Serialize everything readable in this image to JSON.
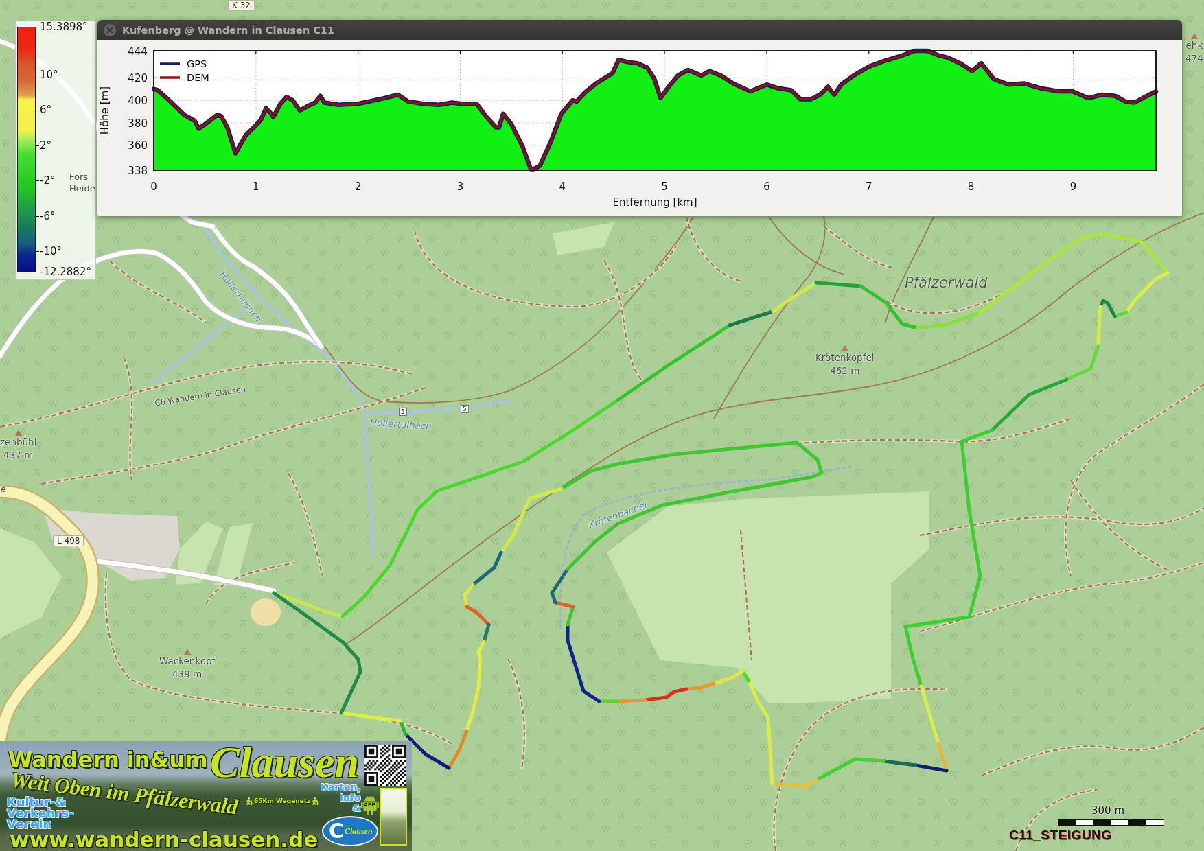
{
  "colorbar": {
    "max_label": "15.3898°",
    "ticks": [
      "10°",
      "6°",
      "2°",
      "-2°",
      "-6°",
      "-10°"
    ],
    "min_label": "-12.2882°"
  },
  "profile_window": {
    "title": "Kufenberg @ Wandern in Clausen C11",
    "chart_data": {
      "type": "area",
      "grid": true,
      "xlabel": "Entfernung [km]",
      "ylabel": "Höhe [m]",
      "xlim": [
        0,
        9.81
      ],
      "ylim": [
        338,
        444
      ],
      "xticks": [
        0,
        1,
        2,
        3,
        4,
        5,
        6,
        7,
        8,
        9
      ],
      "yticks": [
        338,
        360,
        380,
        400,
        420,
        444
      ],
      "x": [
        0,
        0.04,
        0.15,
        0.3,
        0.4,
        0.44,
        0.49,
        0.62,
        0.66,
        0.72,
        0.8,
        0.9,
        0.98,
        1.05,
        1.1,
        1.15,
        1.17,
        1.24,
        1.3,
        1.36,
        1.43,
        1.51,
        1.58,
        1.63,
        1.67,
        1.81,
        2.0,
        2.26,
        2.39,
        2.49,
        2.64,
        2.79,
        2.92,
        3.01,
        3.16,
        3.25,
        3.35,
        3.38,
        3.42,
        3.5,
        3.61,
        3.69,
        3.72,
        3.78,
        3.88,
        3.99,
        4.1,
        4.14,
        4.22,
        4.33,
        4.49,
        4.55,
        4.64,
        4.73,
        4.83,
        4.9,
        4.96,
        5.04,
        5.13,
        5.23,
        5.36,
        5.44,
        5.55,
        5.67,
        5.84,
        6.0,
        6.1,
        6.24,
        6.33,
        6.43,
        6.52,
        6.6,
        6.66,
        6.73,
        6.85,
        7.0,
        7.15,
        7.3,
        7.45,
        7.57,
        7.68,
        7.77,
        7.89,
        8.01,
        8.1,
        8.22,
        8.37,
        8.52,
        8.67,
        8.86,
        8.99,
        9.15,
        9.28,
        9.41,
        9.51,
        9.6,
        9.7,
        9.81
      ],
      "series": [
        {
          "name": "GPS",
          "type": "line",
          "color": "#1c1c5a",
          "values": [
            410,
            409,
            400,
            387,
            382,
            375,
            378,
            387,
            386,
            376,
            353,
            369,
            376,
            383,
            393,
            388,
            385,
            397,
            403,
            400,
            391,
            395,
            398,
            404,
            398,
            396,
            397,
            402,
            405,
            399,
            397,
            396,
            398,
            397,
            397,
            386,
            376,
            376,
            388,
            379,
            359,
            339,
            339,
            342,
            362,
            388,
            400,
            399,
            407,
            415,
            424,
            436,
            434,
            433,
            429,
            419,
            402,
            412,
            422,
            427,
            422,
            426,
            422,
            415,
            408,
            414,
            411,
            409,
            401,
            401,
            405,
            412,
            405,
            414,
            422,
            430,
            435,
            439,
            444,
            444,
            440,
            438,
            433,
            426,
            433,
            419,
            414,
            415,
            411,
            408,
            408,
            402,
            405,
            404,
            399,
            398,
            403,
            408
          ]
        },
        {
          "name": "DEM",
          "type": "area",
          "color": "#12ef12",
          "values": [
            410,
            409,
            400,
            387,
            382,
            375,
            378,
            387,
            386,
            376,
            353,
            369,
            376,
            383,
            393,
            388,
            385,
            397,
            403,
            400,
            391,
            395,
            398,
            404,
            398,
            396,
            397,
            402,
            405,
            399,
            397,
            396,
            398,
            397,
            397,
            386,
            376,
            376,
            388,
            379,
            359,
            339,
            339,
            342,
            362,
            388,
            400,
            399,
            407,
            415,
            424,
            436,
            434,
            433,
            429,
            419,
            402,
            412,
            422,
            427,
            422,
            426,
            422,
            415,
            408,
            414,
            411,
            409,
            401,
            401,
            405,
            412,
            405,
            414,
            422,
            430,
            435,
            439,
            444,
            444,
            440,
            438,
            433,
            426,
            433,
            419,
            414,
            415,
            411,
            408,
            408,
            402,
            405,
            404,
            399,
            398,
            403,
            408
          ]
        }
      ]
    }
  },
  "map_labels": [
    {
      "kind": "road",
      "lines": [
        "K 32"
      ]
    },
    {
      "kind": "peak",
      "lines": [
        "ehk",
        "474"
      ]
    },
    {
      "kind": "place",
      "lines": [
        "Fors",
        "Heide"
      ]
    },
    {
      "kind": "stream",
      "lines": [
        "Hollertalbach"
      ]
    },
    {
      "kind": "region",
      "lines": [
        "Pfälzerwald"
      ]
    },
    {
      "kind": "peak",
      "lines": [
        "Krötenköpfel",
        "462 m"
      ]
    },
    {
      "kind": "trail",
      "lines": [
        "C6 Wandern in Clausen"
      ]
    },
    {
      "kind": "marker",
      "lines": [
        "5"
      ]
    },
    {
      "kind": "marker",
      "lines": [
        "5"
      ]
    },
    {
      "kind": "stream",
      "lines": [
        "Hollertalbach"
      ]
    },
    {
      "kind": "peak",
      "lines": [
        "zenbühl",
        "437 m"
      ]
    },
    {
      "kind": "place",
      "lines": [
        "e"
      ]
    },
    {
      "kind": "stream",
      "lines": [
        "Krötenbachel"
      ]
    },
    {
      "kind": "road",
      "lines": [
        "L 498"
      ]
    },
    {
      "kind": "peak",
      "lines": [
        "Wackenkopf",
        "439 m"
      ]
    }
  ],
  "banner": {
    "title": "Wandern in&um",
    "script_title": "Clausen",
    "slogan": "Weit Oben im Pfälzerwald",
    "association": [
      "Kultur-&",
      "Verkehrs-",
      "Verein"
    ],
    "network": "65Km Wegenetz",
    "app_info": [
      "Karten,",
      "Info",
      "&"
    ],
    "app_badge": "APP",
    "logo": {
      "letter": "C",
      "text": "Clausen"
    },
    "website": "www.wandern-clausen.de"
  },
  "scale_bar": {
    "label": "300 m"
  },
  "layer_name": "C11_STEIGUNG"
}
